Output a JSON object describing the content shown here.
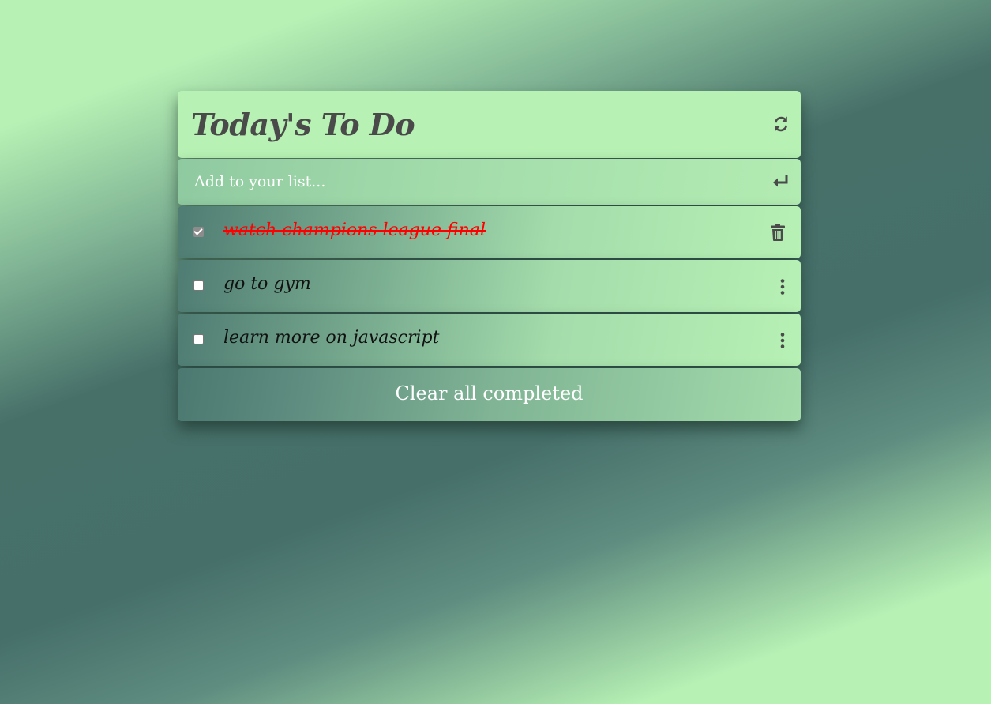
{
  "header": {
    "title": "Today's To Do",
    "refresh_icon": "refresh-icon"
  },
  "add": {
    "placeholder": "Add to your list...",
    "enter_icon": "enter-icon"
  },
  "todos": [
    {
      "text": "watch champions league final",
      "completed": true,
      "action_icon": "trash-icon"
    },
    {
      "text": "go to gym",
      "completed": false,
      "action_icon": "kebab-menu-icon"
    },
    {
      "text": "learn more on javascript",
      "completed": false,
      "action_icon": "kebab-menu-icon"
    }
  ],
  "footer": {
    "clear_label": "Clear all completed"
  },
  "colors": {
    "accent": "#b7f1b4",
    "dark": "#466f6a",
    "completed_text": "#ff0000",
    "icon": "#4a4a4a"
  }
}
